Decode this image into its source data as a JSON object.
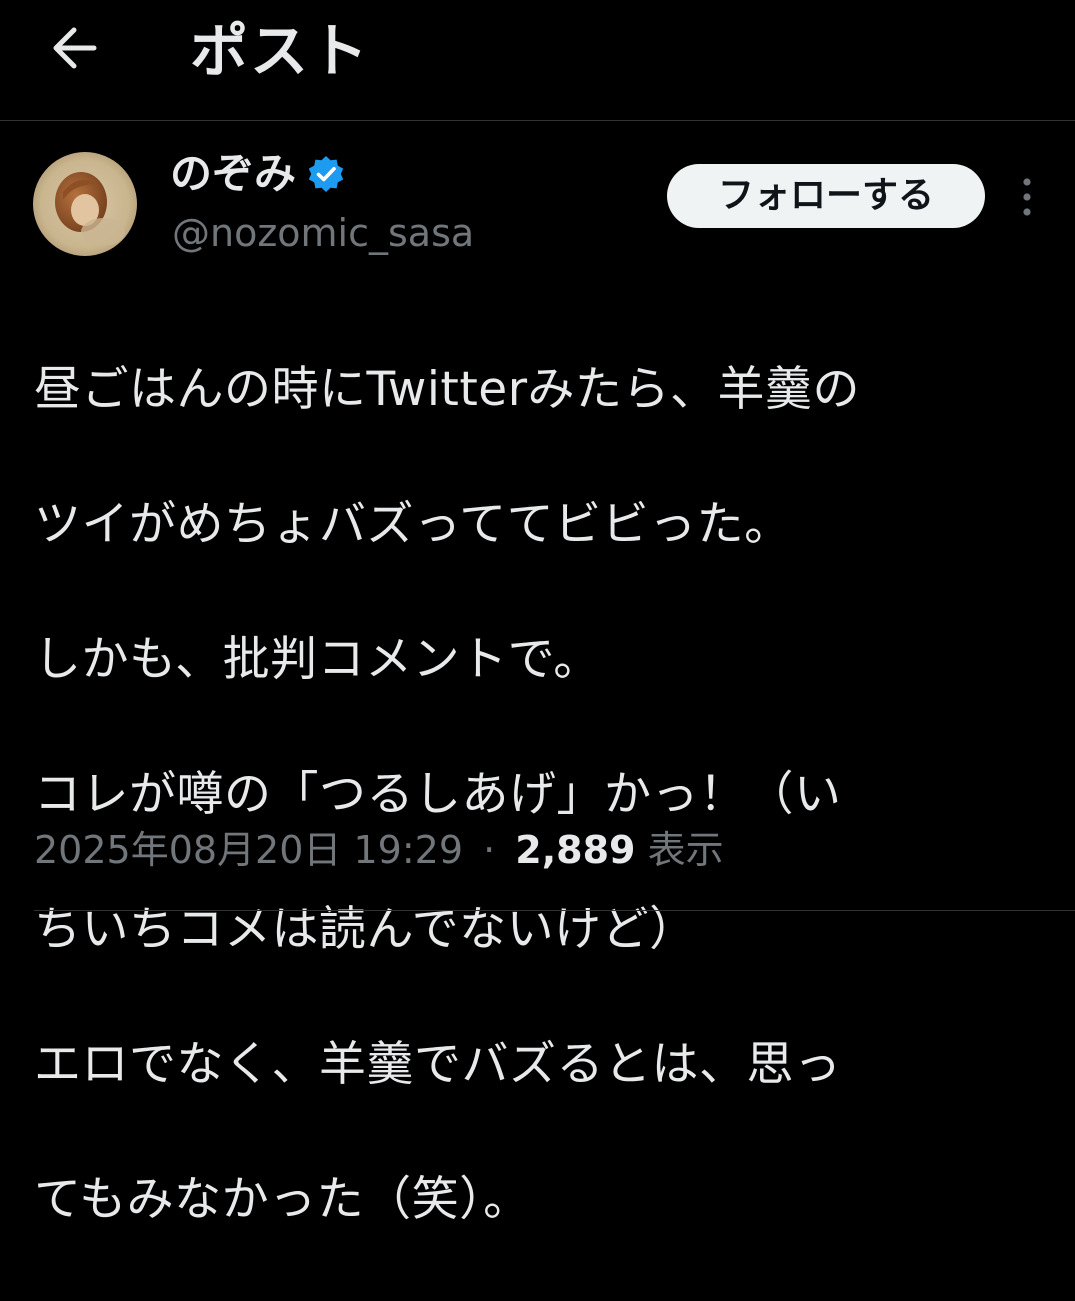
{
  "header": {
    "back_icon": "arrow-left-icon",
    "title": "ポスト"
  },
  "author": {
    "display_name": "のぞみ",
    "handle": "@nozomic_sasa",
    "verified": true,
    "verified_color": "#1d9bf0"
  },
  "actions": {
    "follow_label": "フォローする",
    "more_icon": "more-vertical-icon"
  },
  "post": {
    "lines": [
      "昼ごはんの時にTwitterみたら、羊羹の",
      "ツイがめちょバズっててビビった。",
      "しかも、批判コメントで。",
      "コレが噂の「つるしあげ」かっ！（い",
      "ちいちコメは読んでないけど）",
      "エロでなく、羊羹でバズるとは、思っ",
      "てもみなかった（笑）。"
    ]
  },
  "meta": {
    "timestamp": "2025年08月20日 19:29",
    "separator": "·",
    "views_count": "2,889",
    "views_label": "表示"
  },
  "colors": {
    "background": "#000000",
    "text": "#e7e9ea",
    "secondary": "#71767b",
    "divider": "#2f3336",
    "follow_bg": "#eff3f4"
  }
}
